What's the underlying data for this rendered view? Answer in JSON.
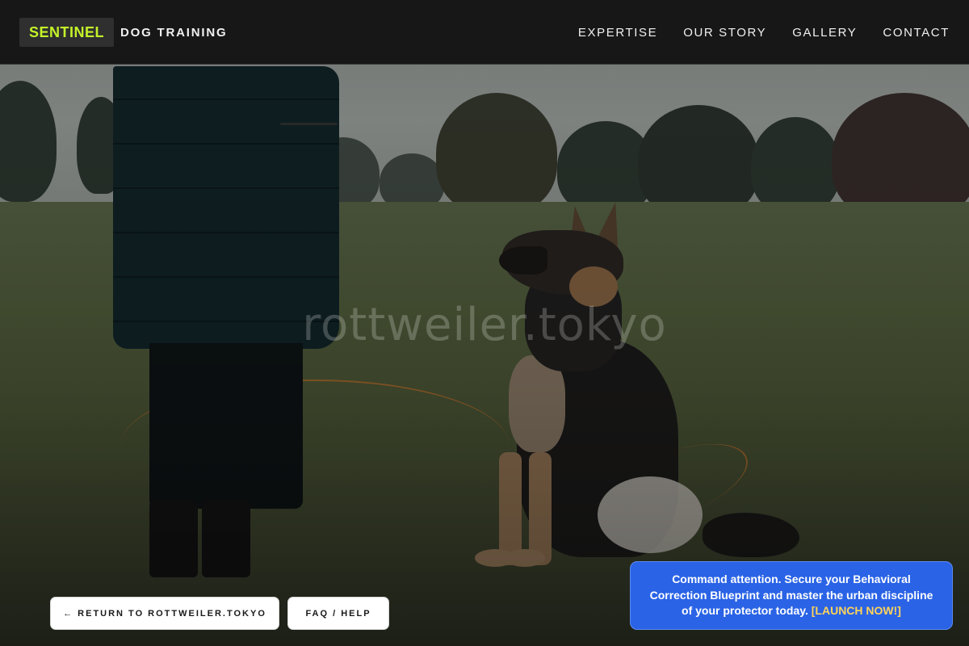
{
  "brand": {
    "badge": "SENTINEL",
    "name": "DOG TRAINING",
    "accent_color": "#c4f22a"
  },
  "nav": {
    "items": [
      {
        "label": "EXPERTISE"
      },
      {
        "label": "OUR STORY"
      },
      {
        "label": "GALLERY"
      },
      {
        "label": "CONTACT"
      }
    ]
  },
  "hero": {
    "watermark": "rottweiler.tokyo",
    "image_subject": "person-with-german-shepherd-dog-in-field"
  },
  "buttons": {
    "return_label": "← RETURN TO ROTTWEILER.TOKYO",
    "faq_label": "FAQ / HELP"
  },
  "cta": {
    "text": "Command attention. Secure your Behavioral Correction Blueprint and master the urban discipline of your protector today.",
    "link_label": "[LAUNCH NOW!]",
    "background_color": "#2a63e6",
    "link_color": "#ffd45a"
  }
}
